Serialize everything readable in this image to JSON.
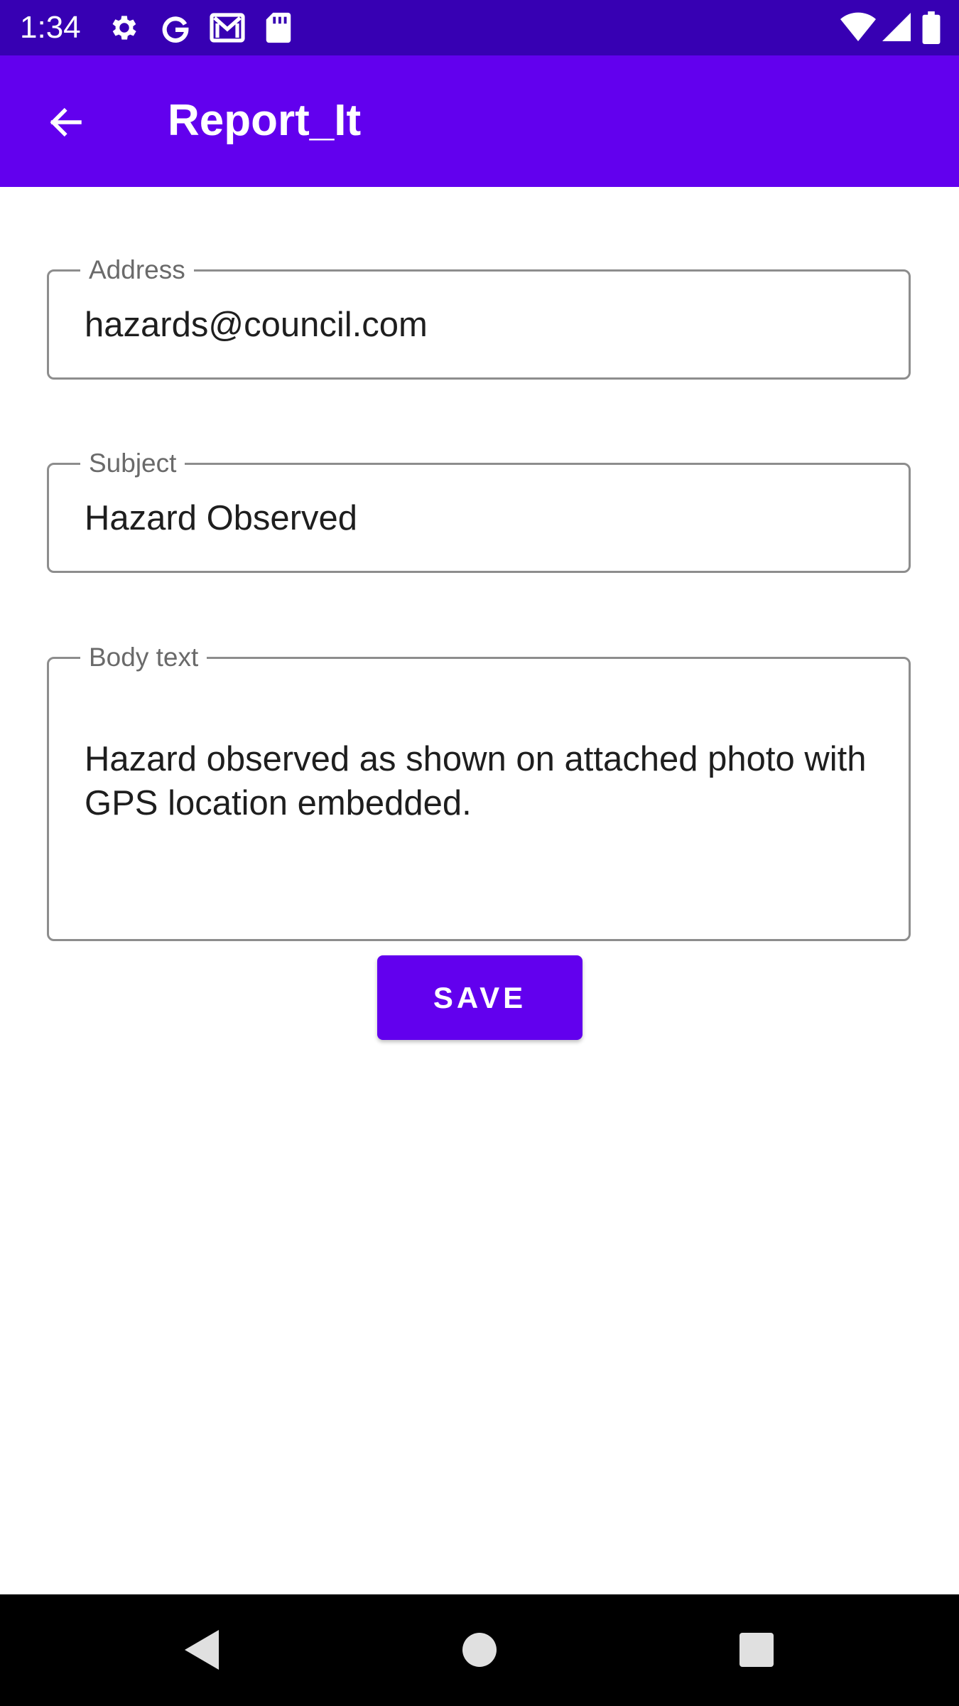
{
  "status_bar": {
    "time": "1:34",
    "icons": [
      "gear-icon",
      "google-icon",
      "gmail-icon",
      "sd-card-icon",
      "wifi-icon",
      "signal-icon",
      "battery-icon"
    ]
  },
  "app_bar": {
    "title": "Report_It",
    "back_icon": "arrow-left-icon",
    "color": "#6200ee",
    "status_color": "#3700b3"
  },
  "form": {
    "address": {
      "label": "Address",
      "value": "hazards@council.com"
    },
    "subject": {
      "label": "Subject",
      "value": "Hazard Observed"
    },
    "body": {
      "label": "Body text",
      "value": "Hazard observed as shown on attached photo with GPS location embedded."
    },
    "save_label": "SAVE"
  },
  "nav_bar": {
    "icons": [
      "back-triangle-icon",
      "home-circle-icon",
      "recents-square-icon"
    ]
  }
}
